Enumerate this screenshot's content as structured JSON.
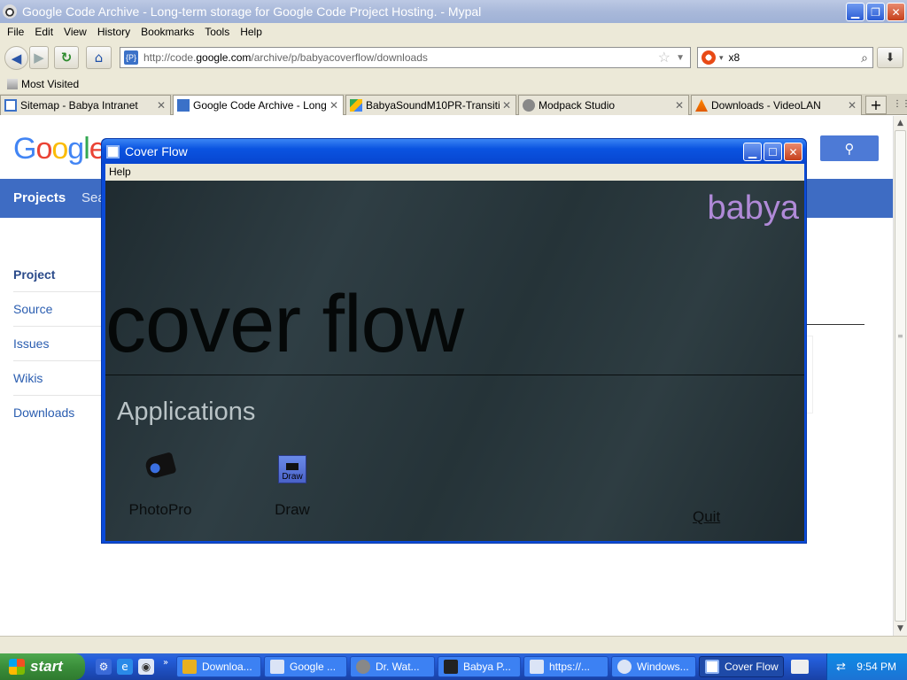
{
  "browser": {
    "window_title": "Google Code Archive - Long-term storage for Google Code Project Hosting. - Mypal",
    "menu": [
      "File",
      "Edit",
      "View",
      "History",
      "Bookmarks",
      "Tools",
      "Help"
    ],
    "url_prefix": "http://code.",
    "url_domain": "google.com",
    "url_path": "/archive/p/babyacoverflow/downloads",
    "search_value": "x8",
    "bookmarks": [
      "Most Visited"
    ],
    "tabs": [
      {
        "label": "Sitemap - Babya Intranet"
      },
      {
        "label": "Google Code Archive - Long-t..."
      },
      {
        "label": "BabyaSoundM10PR-Transitio..."
      },
      {
        "label": "Modpack Studio"
      },
      {
        "label": "Downloads - VideoLAN"
      }
    ]
  },
  "page": {
    "logo_letters": [
      "G",
      "o",
      "o",
      "g",
      "l",
      "e"
    ],
    "nav_projects": "Projects",
    "nav_search_partial": "Sea",
    "sidenav": [
      "Project",
      "Source",
      "Issues",
      "Wikis",
      "Downloads"
    ]
  },
  "dialog": {
    "title": "Cover Flow",
    "menu": [
      "Help"
    ],
    "brand": "babya",
    "heading": "cover flow",
    "section": "Applications",
    "apps": [
      {
        "label": "PhotoPro",
        "icon": "camera-icon"
      },
      {
        "label": "Draw",
        "icon": "draw-icon",
        "icon_text": "Draw"
      }
    ],
    "quit": "Quit"
  },
  "taskbar": {
    "start": "start",
    "items": [
      {
        "label": "Downloa..."
      },
      {
        "label": "Google ..."
      },
      {
        "label": "Dr. Wat..."
      },
      {
        "label": "Babya P..."
      },
      {
        "label": "https://..."
      },
      {
        "label": "Windows..."
      },
      {
        "label": "Cover Flow"
      }
    ],
    "clock": "9:54 PM"
  },
  "colors": {
    "dialog_frame": "#0a4ad8",
    "dialog_body": "#2a383d",
    "brand": "#b08ad8",
    "google_bar": "#3e6cc3",
    "taskbar": "#245edb"
  }
}
